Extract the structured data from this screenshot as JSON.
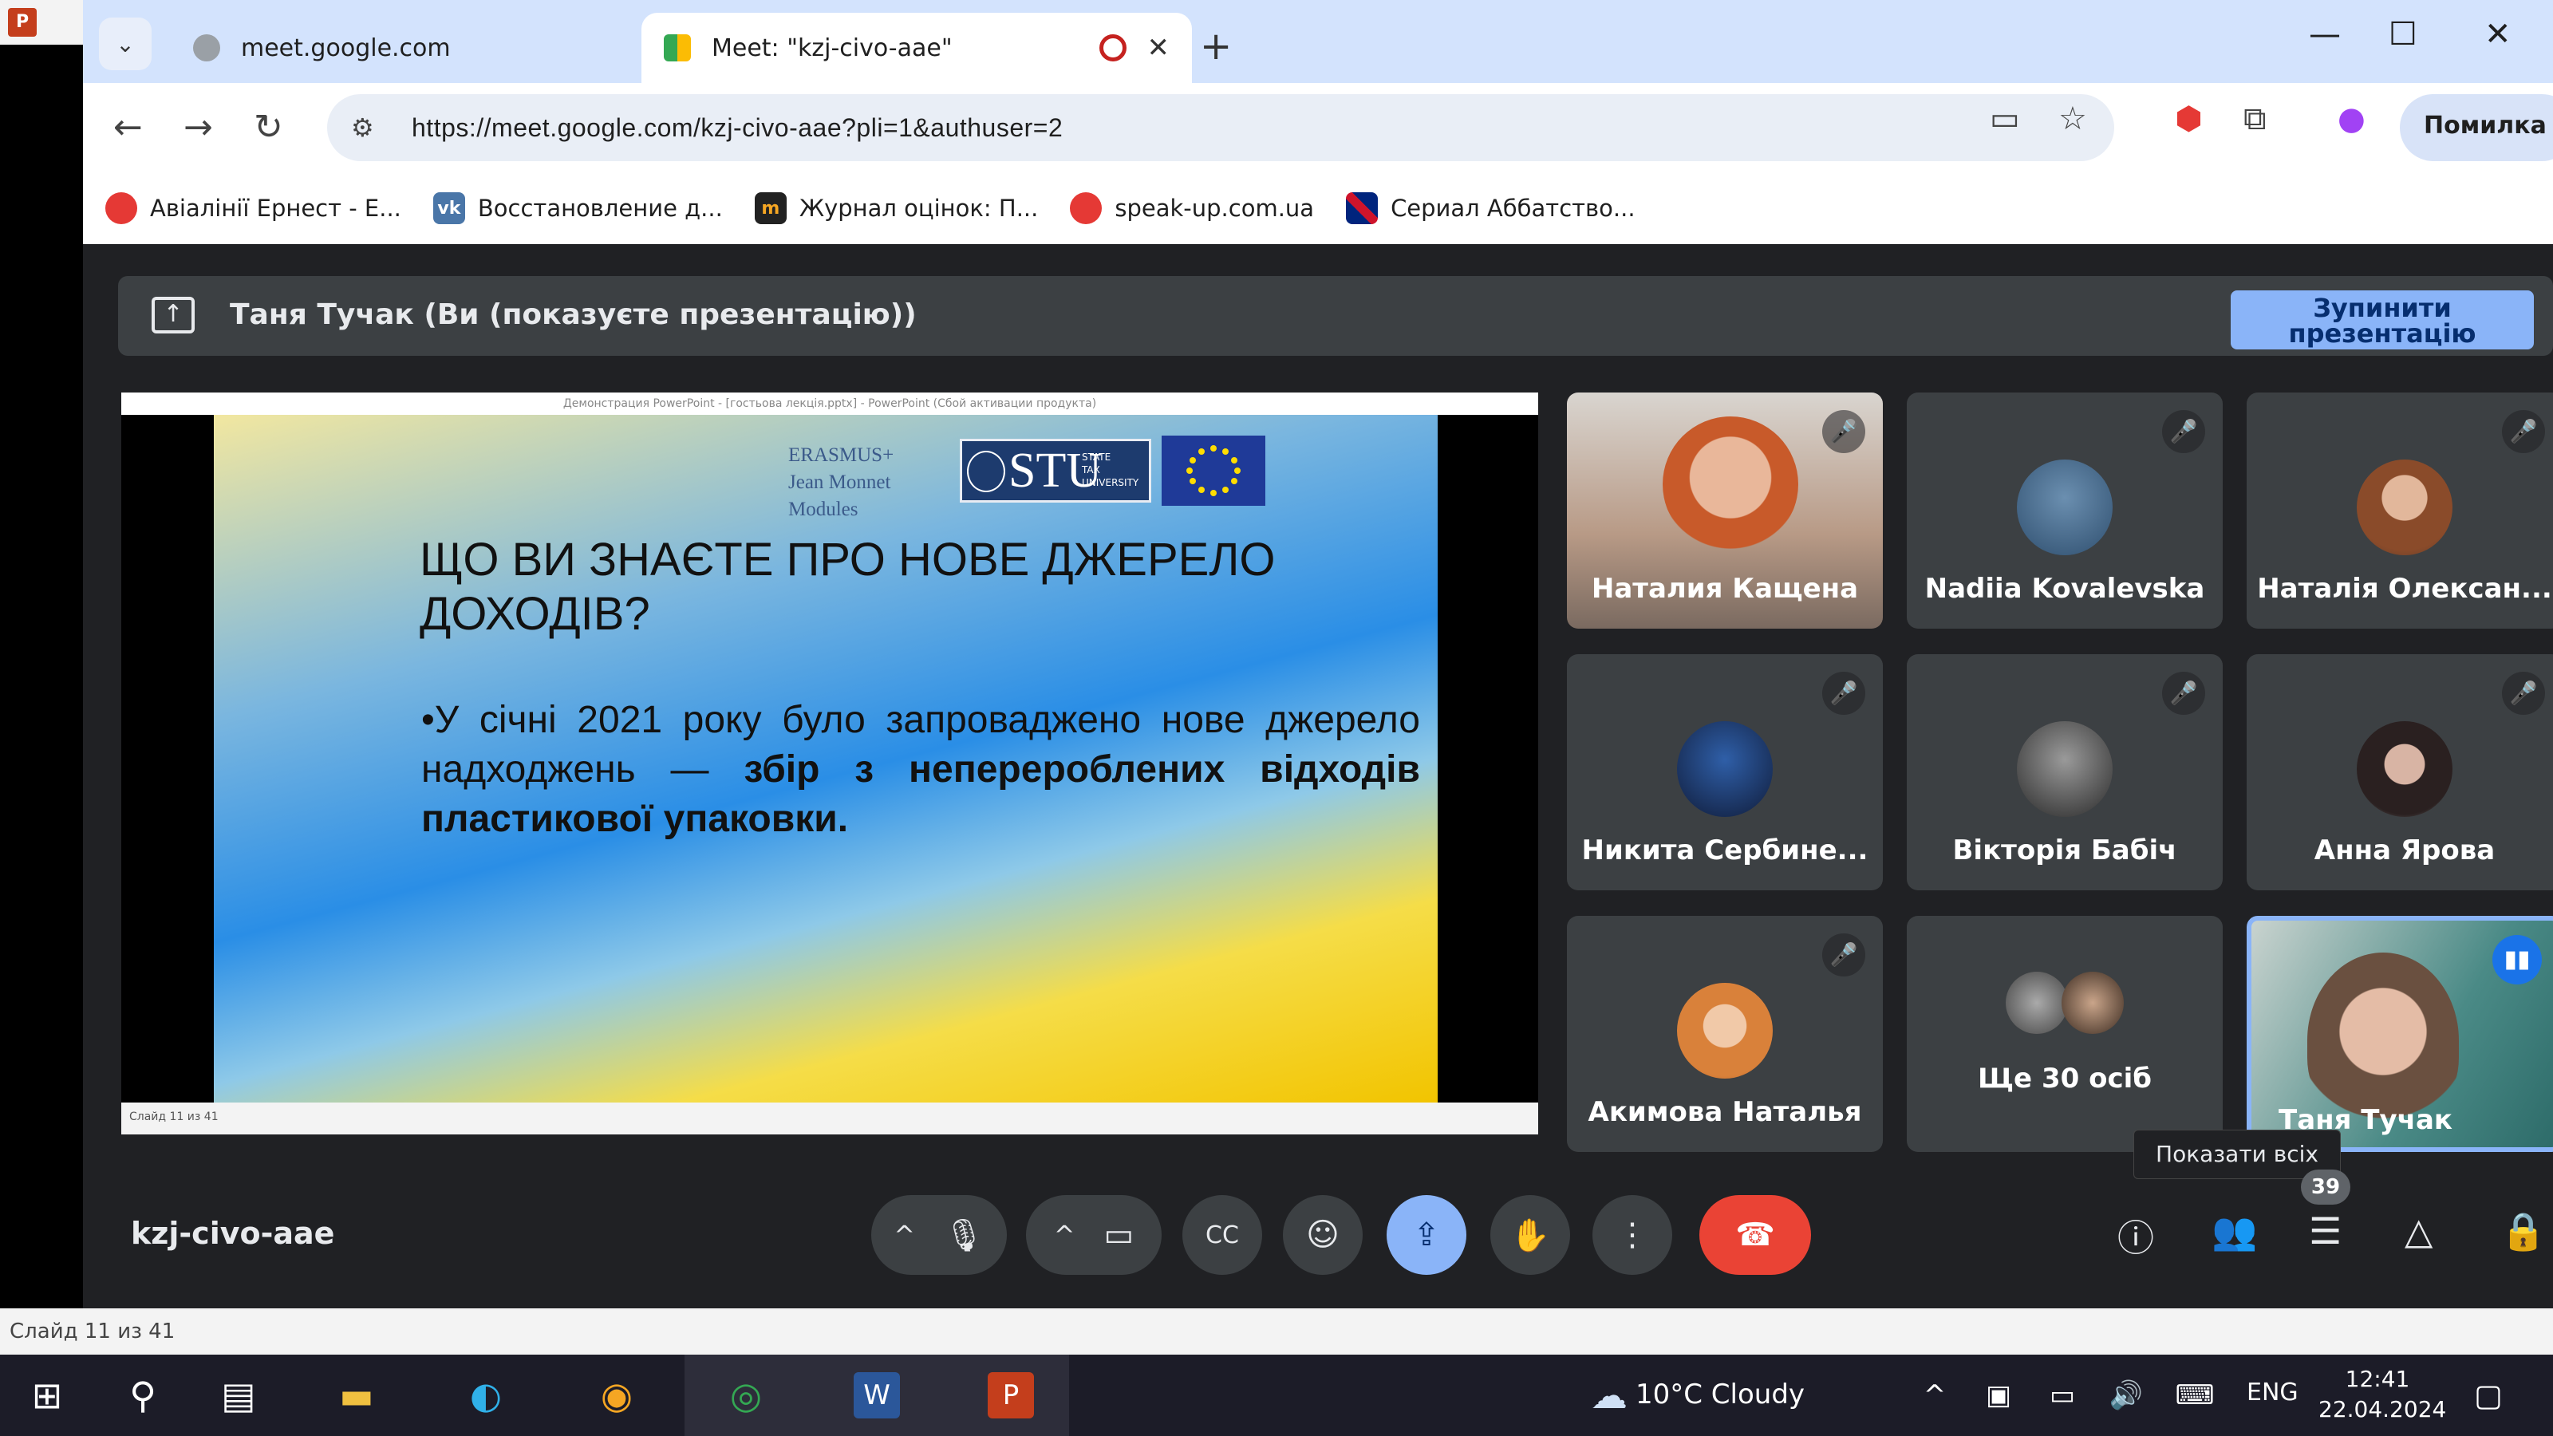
{
  "chrome": {
    "tabs": [
      {
        "title": "meet.google.com"
      },
      {
        "title": "Meet: \"kzj-civo-aae\""
      }
    ],
    "url": "https://meet.google.com/kzj-civo-aae?pli=1&authuser=2",
    "error_label": "Помилка",
    "bookmarks": [
      {
        "label": "Авіалінії Ернест - Е...",
        "color": "#e53935"
      },
      {
        "label": "Восстановление д...",
        "color": "#4a76a8"
      },
      {
        "label": "Журнал оцінок: П...",
        "color": "#222222"
      },
      {
        "label": "speak-up.com.ua",
        "color": "#e53935"
      },
      {
        "label": "Сериал Аббатство...",
        "color": "#00247d"
      }
    ]
  },
  "meet": {
    "presenting_text": "Таня Тучак (Ви (показуєте презентацію))",
    "stop_line1": "Зупинити",
    "stop_line2": "презентацію",
    "meeting_code": "kzj-civo-aae",
    "show_all_tooltip": "Показати всіх",
    "participant_count": "39",
    "participants": [
      {
        "name": "Наталия Кащена"
      },
      {
        "name": "Nadiia Kovalevska"
      },
      {
        "name": "Наталія Олексан..."
      },
      {
        "name": "Никита Сербине..."
      },
      {
        "name": "Вікторія Бабіч"
      },
      {
        "name": "Анна Ярова"
      },
      {
        "name": "Акимова Наталья"
      },
      {
        "name": "Ще 30 осіб"
      },
      {
        "name": "Таня Тучак"
      }
    ]
  },
  "slide": {
    "window_title": "Демонстрация PowerPoint - [гостьова лекція.pptx] - PowerPoint (Сбой активации продукта)",
    "erasmus_lines": [
      "ERASMUS+",
      "Jean Monnet",
      "Modules"
    ],
    "stu_logo": "STU",
    "stu_small": [
      "STATE",
      "TAX",
      "UNIVERSITY"
    ],
    "title_line1": "ЩО ВИ ЗНАЄТЕ ПРО НОВЕ ДЖЕРЕЛО",
    "title_line2": "ДОХОДІВ?",
    "bullet_plain": "•У січні 2021 року було запроваджено нове джерело надходжень — ",
    "bullet_bold": "збір з неперероблених відходів пластикової упаковки.",
    "status": "Слайд 11 из 41"
  },
  "taskbar": {
    "weather": "10°C  Cloudy",
    "lang": "ENG",
    "time": "12:41",
    "date": "22.04.2024"
  },
  "ppt_status": "Слайд 11 из 41"
}
